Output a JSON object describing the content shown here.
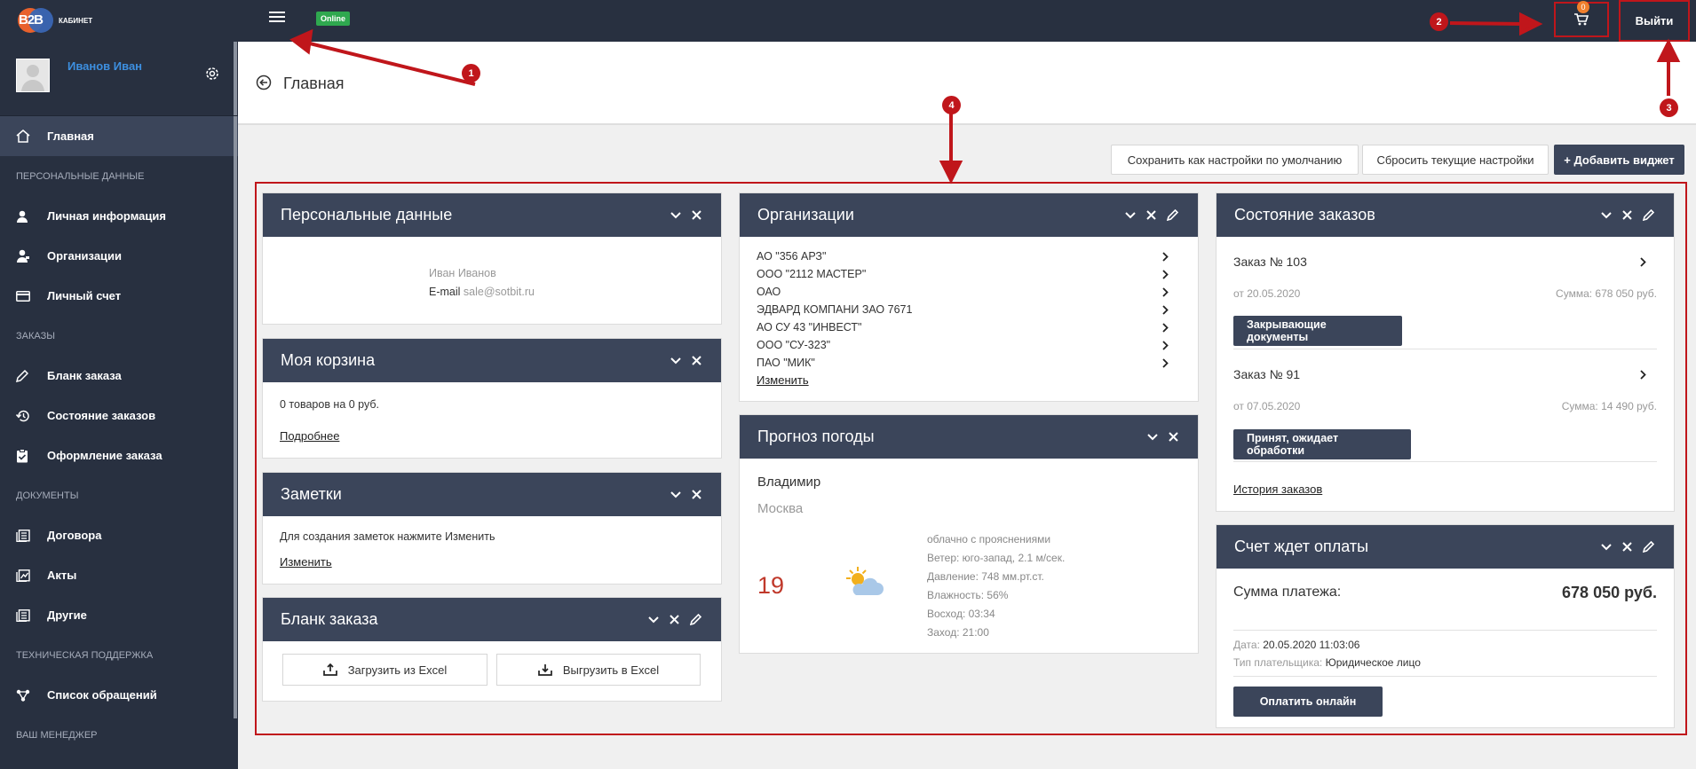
{
  "topbar": {
    "logo_text": "B2B",
    "logo_subtitle": "КАБИНЕТ",
    "online_badge": "Online",
    "cart_count": "0",
    "logout_label": "Выйти"
  },
  "sidebar": {
    "user_name": "Иванов Иван",
    "active_item": "Главная",
    "sections": [
      {
        "title": "ПЕРСОНАЛЬНЫЕ ДАННЫЕ",
        "items": [
          "Личная информация",
          "Организации",
          "Личный счет"
        ]
      },
      {
        "title": "ЗАКАЗЫ",
        "items": [
          "Бланк заказа",
          "Состояние заказов",
          "Оформление заказа"
        ]
      },
      {
        "title": "ДОКУМЕНТЫ",
        "items": [
          "Договора",
          "Акты",
          "Другие"
        ]
      },
      {
        "title": "ТЕХНИЧЕСКАЯ ПОДДЕРЖКА",
        "items": [
          "Список обращений"
        ]
      },
      {
        "title": "ВАШ МЕНЕДЖЕР",
        "items": []
      }
    ]
  },
  "header": {
    "title": "Главная"
  },
  "toolbar": {
    "save_defaults": "Сохранить как настройки по умолчанию",
    "reset": "Сбросить текущие настройки",
    "add_widget": "+ Добавить виджет"
  },
  "widgets": {
    "personal": {
      "title": "Персональные данные",
      "name": "Иван Иванов",
      "email_label": "E-mail",
      "email": "sale@sotbit.ru"
    },
    "cart": {
      "title": "Моя корзина",
      "summary": "0 товаров на 0 руб.",
      "link": "Подробнее"
    },
    "notes": {
      "title": "Заметки",
      "text": "Для создания заметок нажмите Изменить",
      "link": "Изменить"
    },
    "order_form": {
      "title": "Бланк заказа",
      "upload": "Загрузить из Excel",
      "download": "Выгрузить в Excel"
    },
    "orgs": {
      "title": "Организации",
      "items": [
        "АО \"356 АРЗ\"",
        "ООО \"2112 МАСТЕР\"",
        "ОАО",
        "ЭДВАРД КОМПАНИ ЗАО 7671",
        "АО СУ 43 \"ИНВЕСТ\"",
        "ООО \"СУ-323\"",
        "ПАО \"МИК\""
      ],
      "link": "Изменить"
    },
    "weather": {
      "title": "Прогноз погоды",
      "city": "Владимир",
      "city2": "Москва",
      "temp": "19",
      "details": [
        "облачно с прояснениями",
        "Ветер: юго-запад, 2.1 м/сек.",
        "Давление: 748 мм.рт.ст.",
        "Влажность: 56%",
        "Восход: 03:34",
        "Заход: 21:00"
      ]
    },
    "orders": {
      "title": "Состояние заказов",
      "items": [
        {
          "name": "Заказ № 103",
          "date": "от 20.05.2020",
          "sum": "Сумма: 678 050 руб.",
          "status": "Закрывающие документы"
        },
        {
          "name": "Заказ № 91",
          "date": "от 07.05.2020",
          "sum": "Сумма: 14 490 руб.",
          "status": "Принят, ожидает обработки"
        }
      ],
      "link": "История заказов"
    },
    "invoice": {
      "title": "Счет ждет оплаты",
      "sum_label": "Сумма платежа:",
      "sum": "678 050 руб.",
      "date_label": "Дата:",
      "date": "20.05.2020 11:03:06",
      "payer_label": "Тип плательщика:",
      "payer": "Юридическое лицо",
      "pay_button": "Оплатить онлайн"
    }
  },
  "annotations": [
    "1",
    "2",
    "3",
    "4"
  ],
  "colors": {
    "dark": "#283040",
    "widget_head": "#3b455a",
    "accent_red": "#c0161b",
    "online_green": "#2fa84f",
    "link_blue": "#3d8fe0"
  }
}
